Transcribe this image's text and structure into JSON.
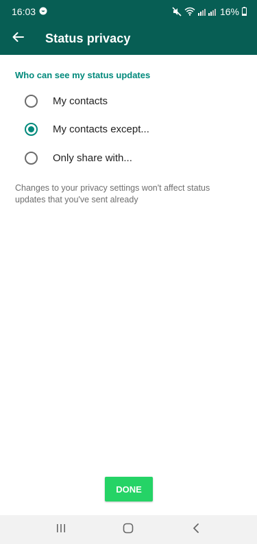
{
  "status_bar": {
    "time": "16:03",
    "battery": "16%"
  },
  "app_bar": {
    "title": "Status privacy"
  },
  "section": {
    "header": "Who can see my status updates"
  },
  "options": [
    {
      "label": "My contacts",
      "selected": false
    },
    {
      "label": "My contacts except...",
      "selected": true
    },
    {
      "label": "Only share with...",
      "selected": false
    }
  ],
  "note": "Changes to your privacy settings won't affect status updates that you've sent already",
  "done_button": {
    "label": "DONE"
  },
  "colors": {
    "toolbar": "#075e54",
    "accent": "#00897b",
    "done": "#25d366"
  },
  "icons": {
    "back": "back-arrow-icon",
    "mute": "mute-icon",
    "wifi": "wifi-icon",
    "signal": "signal-icon",
    "battery": "battery-icon",
    "nav_recent": "recent-apps-icon",
    "nav_home": "home-icon",
    "nav_back": "nav-back-icon"
  }
}
